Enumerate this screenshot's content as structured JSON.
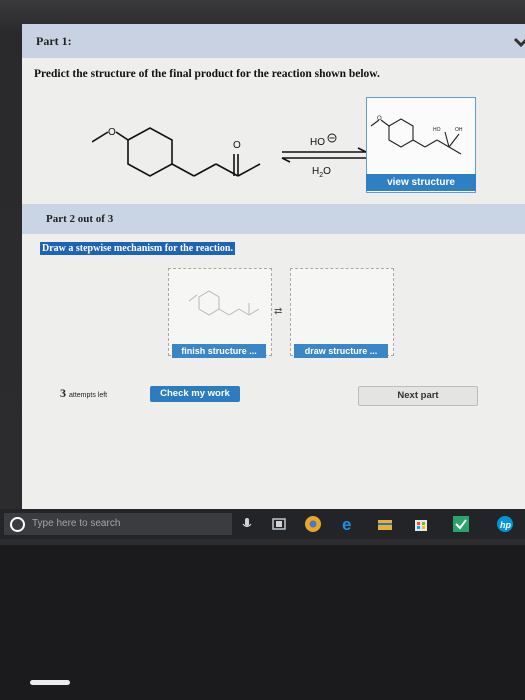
{
  "part1": {
    "header": "Part 1:",
    "question": "Predict the structure of the final product for the reaction shown below.",
    "reagent_top": "HO",
    "reagent_bottom_main": "H",
    "reagent_bottom_sub": "2",
    "reagent_bottom_end": "O",
    "product_labels": [
      "HO",
      "OH"
    ],
    "view_button": "view structure"
  },
  "part2": {
    "header": "Part 2 out of 3",
    "instruction": "Draw a stepwise mechanism for the reaction.",
    "finish_button": "finish structure ...",
    "draw_button": "draw structure ..."
  },
  "footer": {
    "attempts_count": "3",
    "attempts_label": "attempts left",
    "check_button": "Check my work",
    "next_button": "Next part"
  },
  "taskbar": {
    "search_placeholder": "Type here to search"
  },
  "colors": {
    "accent_blue": "#2f7fc3",
    "header_band": "#c8d2e2",
    "taskbar": "#222427"
  }
}
